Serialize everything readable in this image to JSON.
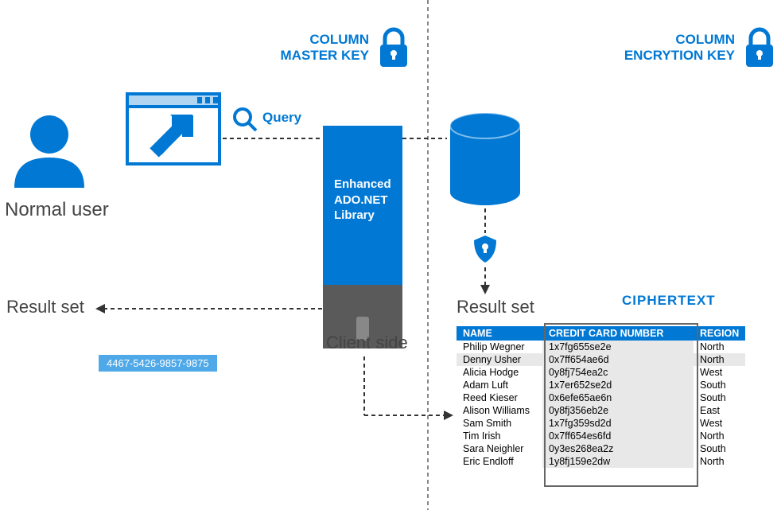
{
  "labels": {
    "master_key1": "COLUMN",
    "master_key2": "MASTER KEY",
    "enc_key1": "COLUMN",
    "enc_key2": "ENCRYTION KEY",
    "normal_user": "Normal user",
    "query": "Query",
    "enhanced": "Enhanced",
    "adonet": "ADO.NET",
    "library": "Library",
    "result_set": "Result set",
    "client_side": "Client side",
    "ciphertext": "CIPHERTEXT"
  },
  "decrypted_cc": "4467-5426-9857-9875",
  "table": {
    "headers": {
      "name": "NAME",
      "cc": "CREDIT CARD NUMBER",
      "region": "REGION"
    },
    "rows": [
      {
        "name": "Philip Wegner",
        "cc": "1x7fg655se2e",
        "region": "North"
      },
      {
        "name": "Denny Usher",
        "cc": "0x7ff654ae6d",
        "region": "North"
      },
      {
        "name": "Alicia Hodge",
        "cc": "0y8fj754ea2c",
        "region": "West"
      },
      {
        "name": "Adam Luft",
        "cc": "1x7er652se2d",
        "region": "South"
      },
      {
        "name": "Reed Kieser",
        "cc": "0x6efe65ae6n",
        "region": "South"
      },
      {
        "name": "Alison Williams",
        "cc": "0y8fj356eb2e",
        "region": "East"
      },
      {
        "name": "Sam Smith",
        "cc": "1x7fg359sd2d",
        "region": "West"
      },
      {
        "name": "Tim Irish",
        "cc": "0x7ff654es6fd",
        "region": "North"
      },
      {
        "name": "Sara Neighler",
        "cc": "0y3es268ea2z",
        "region": "South"
      },
      {
        "name": "Eric Endloff",
        "cc": "1y8fj159e2dw",
        "region": "North"
      }
    ]
  }
}
